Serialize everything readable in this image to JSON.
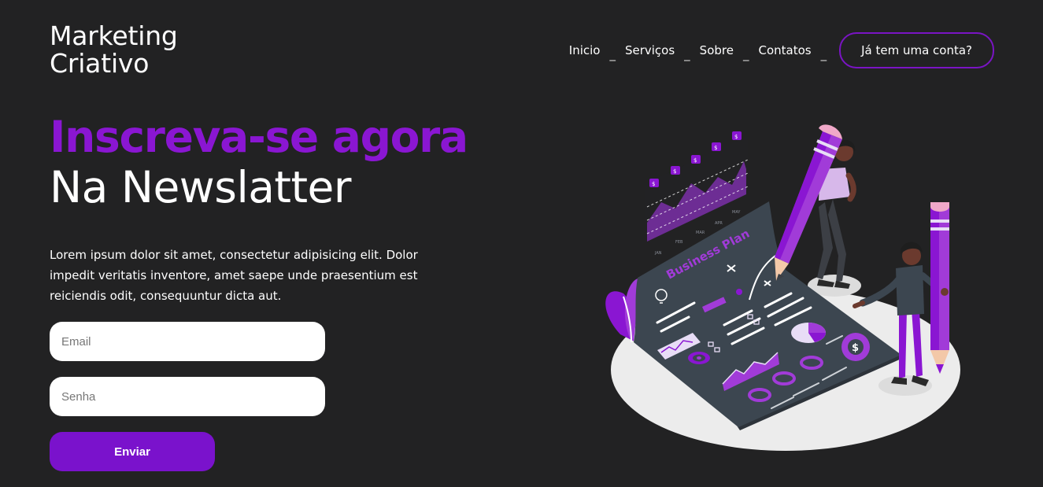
{
  "brand": {
    "line1": "Marketing",
    "line2": "Criativo"
  },
  "nav": {
    "items": [
      "Inicio",
      "Serviços",
      "Sobre",
      "Contatos"
    ],
    "separator": "_",
    "login_label": "Já tem uma conta?"
  },
  "hero": {
    "title_accent": "Inscreva-se agora",
    "title_main": "Na Newslatter",
    "description": "Lorem ipsum dolor sit amet, consectetur adipisicing elit. Dolor impedit veritatis inventore, amet saepe unde praesentium est reiciendis odit, consequuntur dicta aut."
  },
  "form": {
    "email_placeholder": "Email",
    "password_placeholder": "Senha",
    "submit_label": "Enviar"
  },
  "illustration": {
    "doc_title": "Business Plan",
    "colors": {
      "accent": "#8a16d2",
      "purple": "#a13bd8",
      "doc": "#3c4650",
      "floor": "#ececec"
    }
  },
  "colors": {
    "background": "#222223",
    "accent": "#8a16d2",
    "button": "#7a12cc"
  }
}
